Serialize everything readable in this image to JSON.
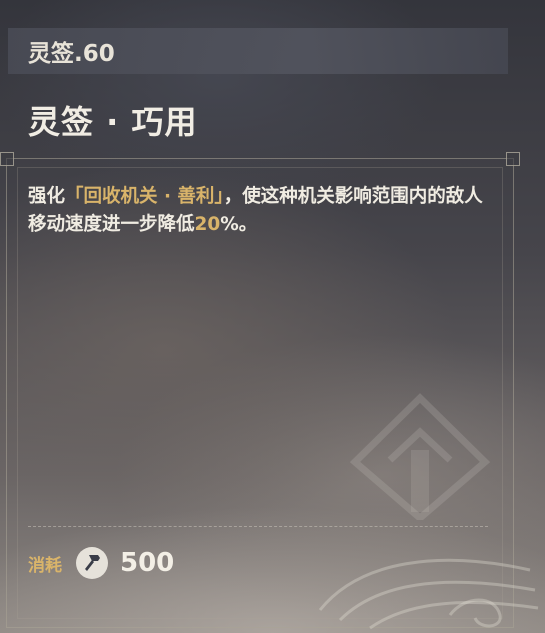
{
  "card": {
    "level_label": "灵签.60",
    "title": "灵签 · 巧用",
    "description": {
      "part1": "强化",
      "highlight_name": "「回收机关 · 善利」",
      "part2": "，使这种机关影响范围内的敌人移动速度进一步降低",
      "highlight_value": "20",
      "part3": "%。"
    },
    "cost": {
      "label": "消耗",
      "icon": "hammer-icon",
      "value": "500"
    }
  },
  "colors": {
    "highlight": "#d9b46a",
    "text": "#f0ece2",
    "level_bar": "#50525e"
  }
}
